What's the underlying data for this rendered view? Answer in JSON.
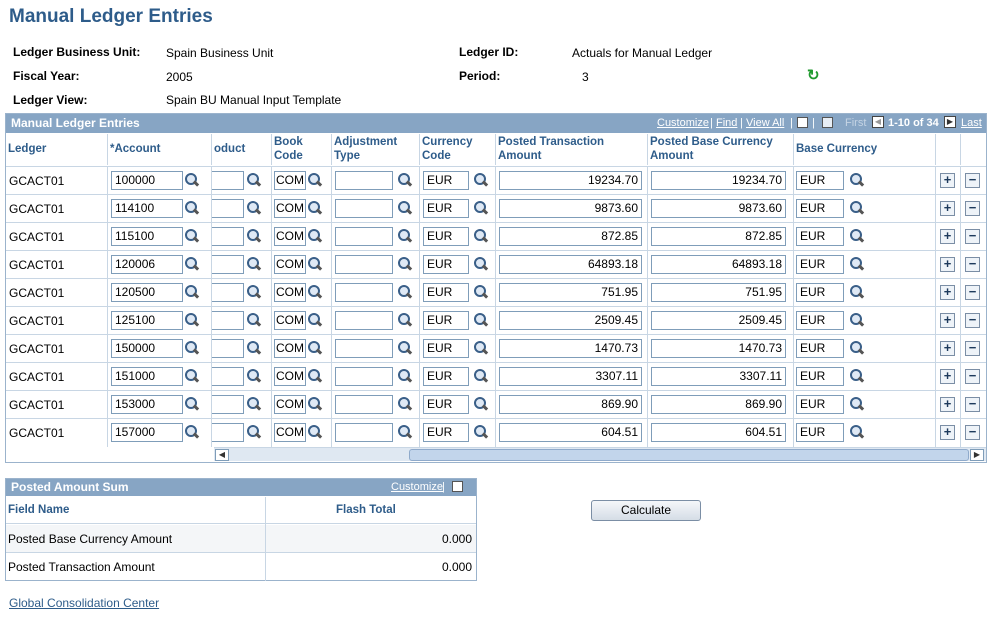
{
  "page": {
    "title": "Manual Ledger Entries"
  },
  "header": {
    "business_unit_label": "Ledger Business Unit:",
    "business_unit_value": "Spain Business Unit",
    "ledger_id_label": "Ledger ID:",
    "ledger_id_value": "Actuals for Manual Ledger",
    "fiscal_year_label": "Fiscal Year:",
    "fiscal_year_value": "2005",
    "period_label": "Period:",
    "period_value": "3",
    "ledger_view_label": "Ledger View:",
    "ledger_view_value": "Spain BU Manual Input Template"
  },
  "grid": {
    "title": "Manual Ledger Entries",
    "customize": "Customize",
    "find": "Find",
    "view_all": "View All",
    "sep": "|",
    "first": "First",
    "range": "1-10 of 34",
    "last": "Last",
    "columns": {
      "ledger": "Ledger",
      "account": "*Account",
      "product": "oduct",
      "book_code_1": "Book",
      "book_code_2": "Code",
      "adjustment_type_1": "Adjustment",
      "adjustment_type_2": "Type",
      "currency_code_1": "Currency",
      "currency_code_2": "Code",
      "posted_transaction_1": "Posted Transaction",
      "posted_transaction_2": "Amount",
      "posted_base_1": "Posted Base Currency",
      "posted_base_2": "Amount",
      "base_currency": "Base Currency"
    },
    "rows": [
      {
        "ledger": "GCACT01",
        "account": "100000",
        "product": "",
        "book_code": "COM",
        "adjustment_type": "",
        "currency_code": "EUR",
        "posted_transaction": "19234.70",
        "posted_base": "19234.70",
        "base_currency": "EUR"
      },
      {
        "ledger": "GCACT01",
        "account": "114100",
        "product": "",
        "book_code": "COM",
        "adjustment_type": "",
        "currency_code": "EUR",
        "posted_transaction": "9873.60",
        "posted_base": "9873.60",
        "base_currency": "EUR"
      },
      {
        "ledger": "GCACT01",
        "account": "115100",
        "product": "",
        "book_code": "COM",
        "adjustment_type": "",
        "currency_code": "EUR",
        "posted_transaction": "872.85",
        "posted_base": "872.85",
        "base_currency": "EUR"
      },
      {
        "ledger": "GCACT01",
        "account": "120006",
        "product": "",
        "book_code": "COM",
        "adjustment_type": "",
        "currency_code": "EUR",
        "posted_transaction": "64893.18",
        "posted_base": "64893.18",
        "base_currency": "EUR"
      },
      {
        "ledger": "GCACT01",
        "account": "120500",
        "product": "",
        "book_code": "COM",
        "adjustment_type": "",
        "currency_code": "EUR",
        "posted_transaction": "751.95",
        "posted_base": "751.95",
        "base_currency": "EUR"
      },
      {
        "ledger": "GCACT01",
        "account": "125100",
        "product": "",
        "book_code": "COM",
        "adjustment_type": "",
        "currency_code": "EUR",
        "posted_transaction": "2509.45",
        "posted_base": "2509.45",
        "base_currency": "EUR"
      },
      {
        "ledger": "GCACT01",
        "account": "150000",
        "product": "",
        "book_code": "COM",
        "adjustment_type": "",
        "currency_code": "EUR",
        "posted_transaction": "1470.73",
        "posted_base": "1470.73",
        "base_currency": "EUR"
      },
      {
        "ledger": "GCACT01",
        "account": "151000",
        "product": "",
        "book_code": "COM",
        "adjustment_type": "",
        "currency_code": "EUR",
        "posted_transaction": "3307.11",
        "posted_base": "3307.11",
        "base_currency": "EUR"
      },
      {
        "ledger": "GCACT01",
        "account": "153000",
        "product": "",
        "book_code": "COM",
        "adjustment_type": "",
        "currency_code": "EUR",
        "posted_transaction": "869.90",
        "posted_base": "869.90",
        "base_currency": "EUR"
      },
      {
        "ledger": "GCACT01",
        "account": "157000",
        "product": "",
        "book_code": "COM",
        "adjustment_type": "",
        "currency_code": "EUR",
        "posted_transaction": "604.51",
        "posted_base": "604.51",
        "base_currency": "EUR"
      }
    ],
    "add_row_symbol": "+",
    "delete_row_symbol": "−"
  },
  "sum_grid": {
    "title": "Posted Amount Sum",
    "customize": "Customize",
    "col_field_name": "Field Name",
    "col_flash_total": "Flash Total",
    "rows": [
      {
        "field": "Posted Base Currency Amount",
        "total": "0.000"
      },
      {
        "field": "Posted Transaction Amount",
        "total": "0.000"
      }
    ]
  },
  "calculate_label": "Calculate",
  "link_label": "Global Consolidation Center",
  "colors": {
    "accent": "#2e5c8a",
    "bar": "#87a5c4",
    "refresh": "#1f9a2e"
  },
  "icons": {
    "lookup": "magnifier-icon",
    "refresh": "refresh-icon"
  }
}
